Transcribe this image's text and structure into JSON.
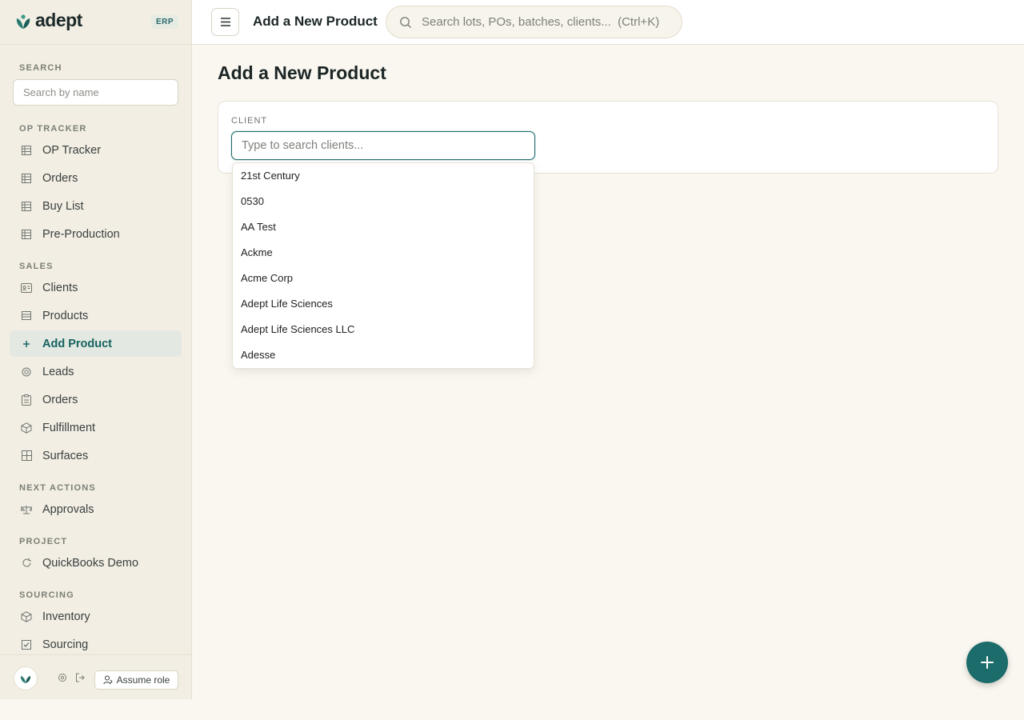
{
  "brand": {
    "name": "adept",
    "badge": "ERP"
  },
  "sidebar": {
    "search": {
      "label": "SEARCH",
      "placeholder": "Search by name"
    },
    "sections": [
      {
        "label": "OP TRACKER",
        "items": [
          {
            "label": "OP Tracker",
            "icon": "table-icon"
          },
          {
            "label": "Orders",
            "icon": "table-icon"
          },
          {
            "label": "Buy List",
            "icon": "table-icon"
          },
          {
            "label": "Pre-Production",
            "icon": "table-icon"
          }
        ]
      },
      {
        "label": "SALES",
        "items": [
          {
            "label": "Clients",
            "icon": "id-card-icon"
          },
          {
            "label": "Products",
            "icon": "list-icon"
          },
          {
            "label": "Add Product",
            "icon": "plus-icon",
            "active": true
          },
          {
            "label": "Leads",
            "icon": "target-icon"
          },
          {
            "label": "Orders",
            "icon": "clipboard-icon"
          },
          {
            "label": "Fulfillment",
            "icon": "package-icon"
          },
          {
            "label": "Surfaces",
            "icon": "grid-icon"
          }
        ]
      },
      {
        "label": "NEXT ACTIONS",
        "items": [
          {
            "label": "Approvals",
            "icon": "scale-icon"
          }
        ]
      },
      {
        "label": "PROJECT",
        "items": [
          {
            "label": "QuickBooks Demo",
            "icon": "refresh-icon"
          }
        ]
      },
      {
        "label": "SOURCING",
        "items": [
          {
            "label": "Inventory",
            "icon": "box-icon"
          },
          {
            "label": "Sourcing",
            "icon": "checkbox-icon"
          }
        ]
      }
    ],
    "footer": {
      "assume_role": "Assume role"
    }
  },
  "topbar": {
    "title": "Add a New Product",
    "search_placeholder": "Search lots, POs, batches, clients...  (Ctrl+K)"
  },
  "main": {
    "page_title": "Add a New Product",
    "client_label": "CLIENT",
    "client_placeholder": "Type to search clients...",
    "client_options": [
      "21st Century",
      "0530",
      "AA Test",
      "Ackme",
      "Acme Corp",
      "Adept Life Sciences",
      "Adept Life Sciences LLC",
      "Adesse"
    ]
  },
  "colors": {
    "accent": "#1b6c6a",
    "sidebar_bg": "#f3eee3",
    "page_bg": "#faf7f0"
  }
}
